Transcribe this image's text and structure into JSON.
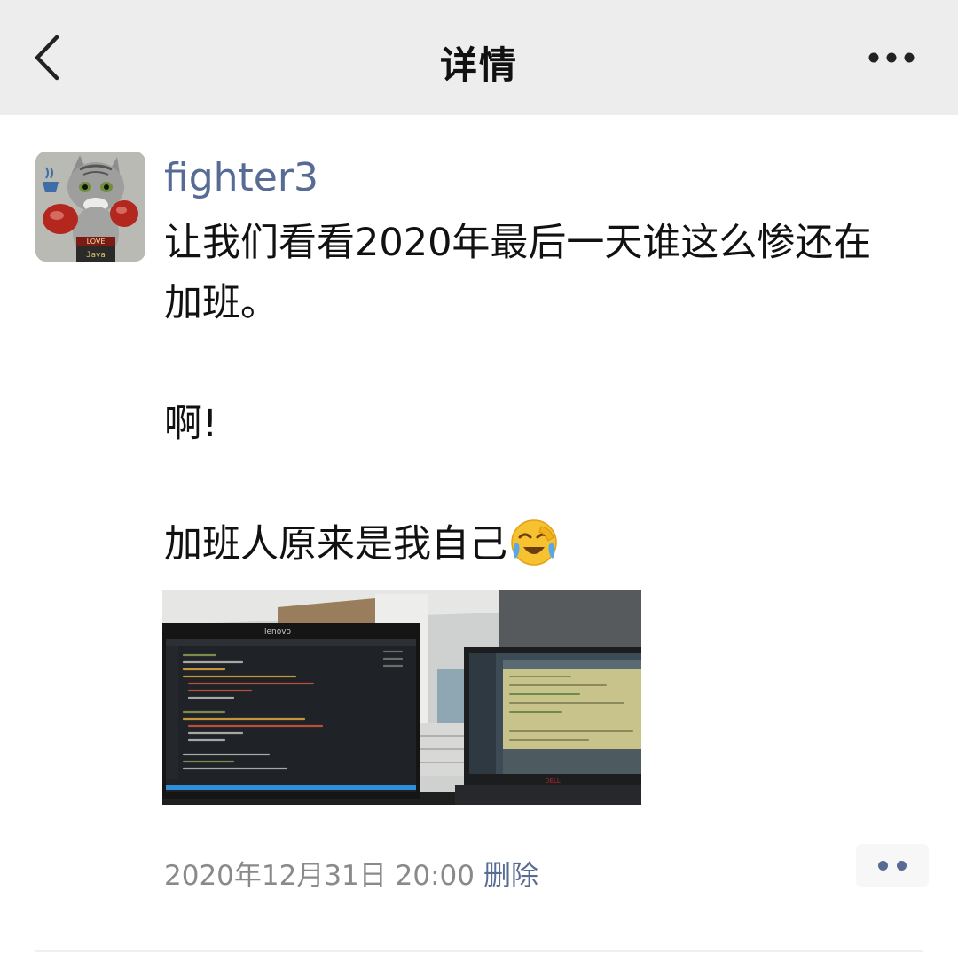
{
  "nav": {
    "title": "详情",
    "back_icon": "chevron-left-icon",
    "more_icon": "more-horizontal-icon"
  },
  "post": {
    "username": "fighter3",
    "avatar_badge": "LOVE",
    "avatar_shorts": "Java",
    "lines": [
      "让我们看看2020年最后一天谁这么惨还在",
      "加班。",
      "",
      "啊!",
      "",
      "加班人原来是我自己"
    ],
    "emoji": "face-with-tears-of-joy-icon",
    "photo_monitor_brand": "lenovo",
    "photo_laptop_brand": "DELL",
    "timestamp": "2020年12月31日 20:00",
    "delete_label": "删除",
    "action_icon": "comment-like-dots-icon"
  },
  "colors": {
    "nav_bg": "#ededed",
    "link": "#576b95",
    "text": "#111111",
    "meta": "#8a8a8a"
  }
}
